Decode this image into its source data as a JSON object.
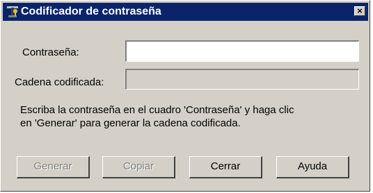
{
  "window": {
    "title": "Codificador de contraseña",
    "close_label": "×",
    "title_icon": "key-app-icon",
    "colors": {
      "titlebar": "#0a246a",
      "face": "#d4d0c8"
    }
  },
  "form": {
    "password_label": "Contraseña:",
    "password_value": "",
    "encoded_label": "Cadena codificada:",
    "encoded_value": ""
  },
  "help": {
    "line1": "Escriba la contraseña en el cuadro 'Contraseña' y haga clic",
    "line2": "en 'Generar' para generar la cadena codificada."
  },
  "buttons": {
    "generate": "Generar",
    "copy": "Copiar",
    "close": "Cerrar",
    "help": "Ayuda"
  }
}
